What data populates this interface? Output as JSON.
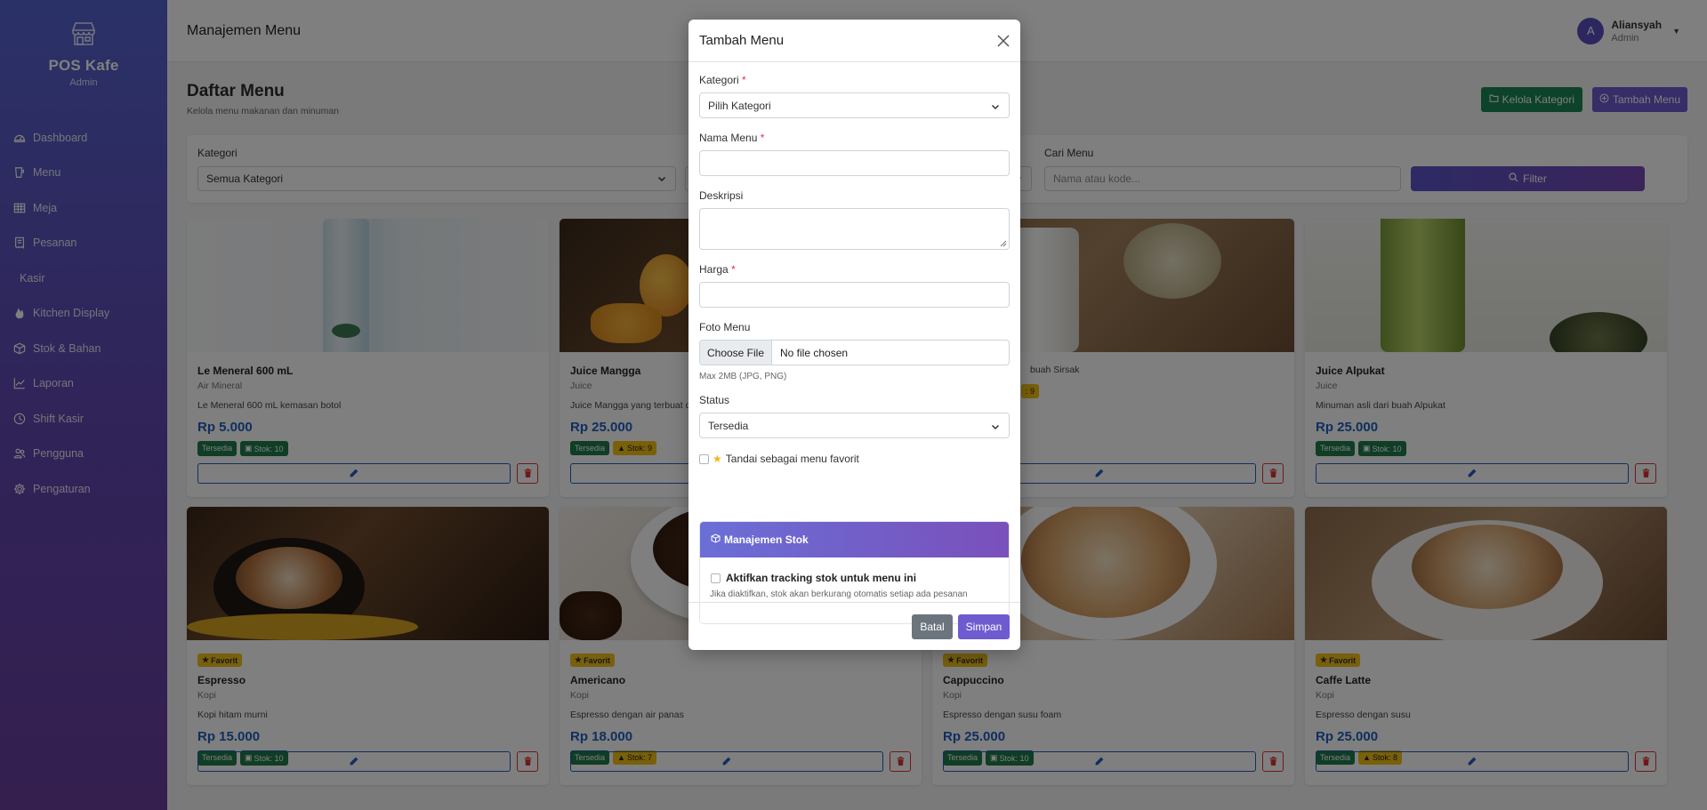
{
  "app": {
    "name": "POS Kafe",
    "role": "Admin"
  },
  "sidebar": {
    "items": [
      {
        "label": "Dashboard",
        "icon": "speedometer-icon"
      },
      {
        "label": "Menu",
        "icon": "cup-icon"
      },
      {
        "label": "Meja",
        "icon": "table-icon"
      },
      {
        "label": "Pesanan",
        "icon": "receipt-icon"
      },
      {
        "label": "Kasir",
        "icon": ""
      },
      {
        "label": "Kitchen Display",
        "icon": "fire-icon"
      },
      {
        "label": "Stok & Bahan",
        "icon": "box-icon"
      },
      {
        "label": "Laporan",
        "icon": "chart-icon"
      },
      {
        "label": "Shift Kasir",
        "icon": "clock-icon"
      },
      {
        "label": "Pengguna",
        "icon": "people-icon"
      },
      {
        "label": "Pengaturan",
        "icon": "gear-icon"
      }
    ]
  },
  "topbar": {
    "title": "Manajemen Menu",
    "user_initial": "A",
    "user_name": "Aliansyah",
    "user_role": "Admin"
  },
  "page": {
    "title": "Daftar Menu",
    "subtitle": "Kelola menu makanan dan minuman",
    "kelola_label": "Kelola Kategori",
    "tambah_label": "Tambah Menu"
  },
  "filters": {
    "kategori_label": "Kategori",
    "kategori_value": "Semua Kategori",
    "cari_label": "Cari Menu",
    "cari_placeholder": "Nama atau kode...",
    "filter_label": "Filter"
  },
  "cards": [
    {
      "name": "Le Meneral 600 mL",
      "category": "Air Mineral",
      "desc": "Le Meneral 600 mL kemasan botol",
      "price": "Rp 5.000",
      "status": "Tersedia",
      "stock": "Stok: 10",
      "stock_low": false,
      "favorite": false
    },
    {
      "name": "Juice Mangga",
      "category": "Juice",
      "desc": "Juice Mangga yang terbuat d",
      "price": "Rp 25.000",
      "status": "Tersedia",
      "stock": "Stok: 9",
      "stock_low": true,
      "favorite": false
    },
    {
      "name": "",
      "category": "",
      "desc": "buah Sirsak",
      "price": "",
      "status": "",
      "stock": ": 9",
      "stock_low": true,
      "favorite": false
    },
    {
      "name": "Juice Alpukat",
      "category": "Juice",
      "desc": "Minuman asli dari buah Alpukat",
      "price": "Rp 25.000",
      "status": "Tersedia",
      "stock": "Stok: 10",
      "stock_low": false,
      "favorite": false
    },
    {
      "name": "Espresso",
      "category": "Kopi",
      "desc": "Kopi hitam murni",
      "price": "Rp 15.000",
      "status": "Tersedia",
      "stock": "Stok: 10",
      "stock_low": false,
      "favorite": true,
      "fav_label": "Favorit"
    },
    {
      "name": "Americano",
      "category": "Kopi",
      "desc": "Espresso dengan air panas",
      "price": "Rp 18.000",
      "status": "Tersedia",
      "stock": "Stok: 7",
      "stock_low": true,
      "favorite": true,
      "fav_label": "Favorit"
    },
    {
      "name": "Cappuccino",
      "category": "Kopi",
      "desc": "Espresso dengan susu foam",
      "price": "Rp 25.000",
      "status": "Tersedia",
      "stock": "Stok: 10",
      "stock_low": false,
      "favorite": true,
      "fav_label": "Favorit"
    },
    {
      "name": "Caffe Latte",
      "category": "Kopi",
      "desc": "Espresso dengan susu",
      "price": "Rp 25.000",
      "status": "Tersedia",
      "stock": "Stok: 8",
      "stock_low": true,
      "favorite": true,
      "fav_label": "Favorit"
    }
  ],
  "modal": {
    "title": "Tambah Menu",
    "kategori_label": "Kategori",
    "kategori_value": "Pilih Kategori",
    "nama_label": "Nama Menu",
    "nama_value": "",
    "deskripsi_label": "Deskripsi",
    "deskripsi_value": "",
    "harga_label": "Harga",
    "harga_value": "",
    "foto_label": "Foto Menu",
    "file_button": "Choose File",
    "file_status": "No file chosen",
    "foto_hint": "Max 2MB (JPG, PNG)",
    "status_label": "Status",
    "status_value": "Tersedia",
    "favorit_label": "Tandai sebagai menu favorit",
    "stok_title": "Manajemen Stok",
    "stok_check_label": "Aktifkan tracking stok untuk menu ini",
    "stok_hint": "Jika diaktifkan, stok akan berkurang otomatis setiap ada pesanan",
    "batal_label": "Batal",
    "simpan_label": "Simpan",
    "required_mark": "*"
  },
  "colors": {
    "sidebar_top": "#5563cf",
    "sidebar_bottom": "#6a3f9e",
    "accent": "#6f5bd0",
    "success": "#198754",
    "price": "#1f5fbf",
    "warning": "#f2c012",
    "danger": "#dc3545"
  }
}
